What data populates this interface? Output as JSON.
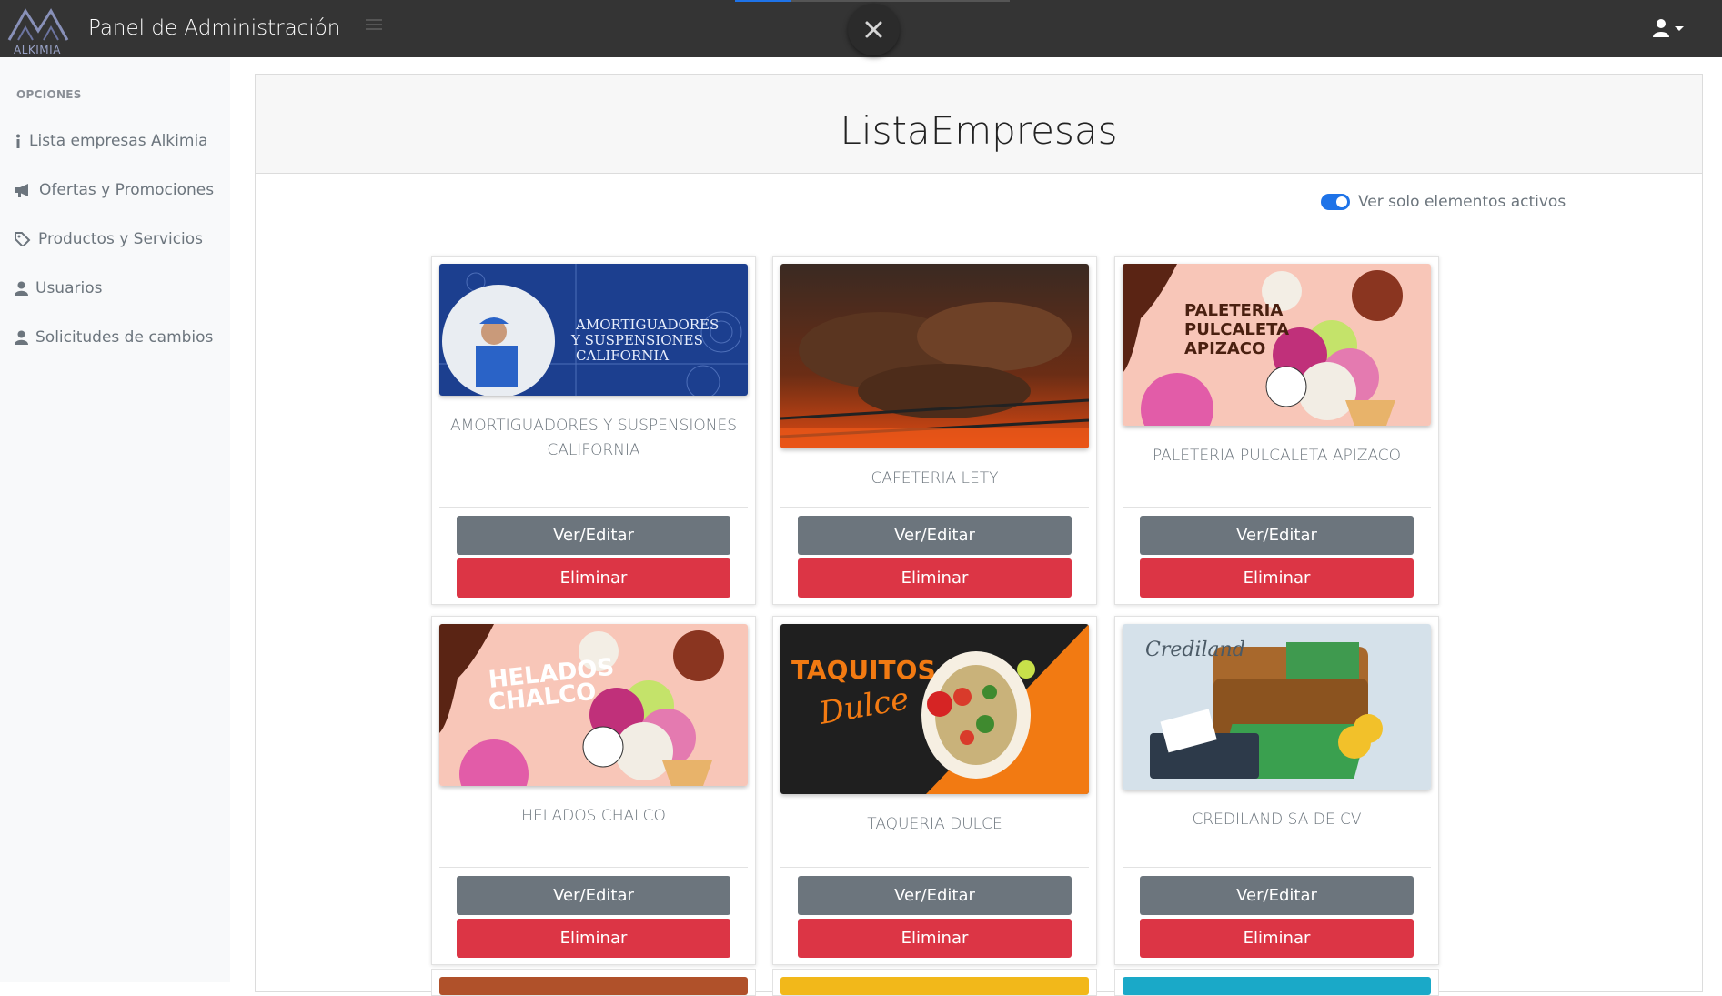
{
  "app": {
    "title": "Panel de Administración",
    "brand_text": "ALKIMIA",
    "accent_color": "#1e73e8",
    "topbar_color": "#343434"
  },
  "sidebar": {
    "heading": "OPCIONES",
    "items": [
      {
        "label": "Lista empresas Alkimia",
        "icon": "info-icon"
      },
      {
        "label": "Ofertas y Promociones",
        "icon": "megaphone-icon"
      },
      {
        "label": "Productos y Servicios",
        "icon": "tag-icon"
      },
      {
        "label": "Usuarios",
        "icon": "user-icon"
      },
      {
        "label": "Solicitudes de cambios",
        "icon": "user-icon"
      }
    ]
  },
  "main": {
    "title": "ListaEmpresas",
    "active_toggle": {
      "label": "Ver solo elementos activos",
      "checked": true
    }
  },
  "companies": [
    {
      "name": "AMORTIGUADORES Y SUSPENSIONES CALIFORNIA",
      "image_text": [
        "AMORTIGUADORES",
        "Y SUSPENSIONES",
        "CALIFORNIA"
      ],
      "edit_label": "Ver/Editar",
      "delete_label": "Eliminar"
    },
    {
      "name": "CAFETERIA LETY",
      "edit_label": "Ver/Editar",
      "delete_label": "Eliminar"
    },
    {
      "name": "PALETERIA PULCALETA APIZACO",
      "image_text": [
        "PALETERIA",
        "PULCALETA",
        "APIZACO"
      ],
      "edit_label": "Ver/Editar",
      "delete_label": "Eliminar"
    },
    {
      "name": "HELADOS CHALCO",
      "image_text": [
        "HELADOS",
        "CHALCO"
      ],
      "edit_label": "Ver/Editar",
      "delete_label": "Eliminar"
    },
    {
      "name": "TAQUERIA DULCE",
      "image_text": [
        "TAQUITOS",
        "Dulce"
      ],
      "edit_label": "Ver/Editar",
      "delete_label": "Eliminar"
    },
    {
      "name": "CREDILAND SA DE CV",
      "image_text": [
        "Crediland"
      ],
      "edit_label": "Ver/Editar",
      "delete_label": "Eliminar"
    }
  ]
}
